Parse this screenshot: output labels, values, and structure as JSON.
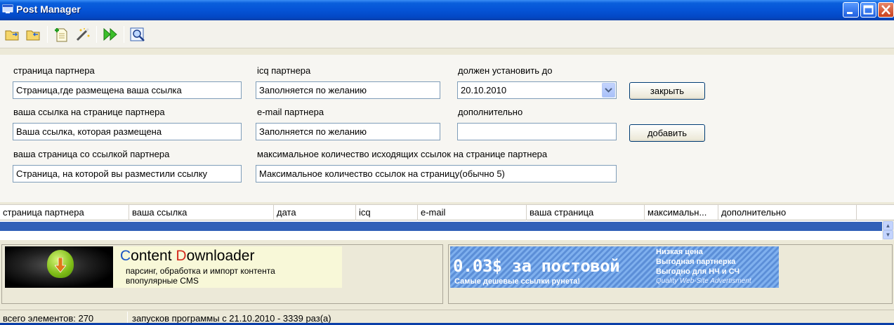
{
  "window": {
    "title": "Post Manager"
  },
  "form": {
    "partner_page": {
      "label": "страница партнера",
      "value": "Страница,где размещена ваша ссылка"
    },
    "partner_icq": {
      "label": "icq партнера",
      "value": "Заполняется по желанию"
    },
    "deadline": {
      "label": "должен установить до",
      "value": "20.10.2010"
    },
    "your_link": {
      "label": "ваша ссылка на странице партнера",
      "value": "Ваша ссылка, которая размещена"
    },
    "partner_email": {
      "label": "e-mail партнера",
      "value": "Заполняется по желанию"
    },
    "extra": {
      "label": "дополнительно",
      "value": ""
    },
    "your_page": {
      "label": "ваша страница со ссылкой партнера",
      "value": "Страница, на которой вы разместили ссылку"
    },
    "max_links": {
      "label": "максимальное количество исходящих ссылок на странице партнера",
      "value": "Максимальное количество ссылок на страницу(обычно 5)"
    },
    "close_button": "закрыть",
    "add_button": "добавить"
  },
  "grid": {
    "columns": [
      "страница партнера",
      "ваша ссылка",
      "дата",
      "icq",
      "e-mail",
      "ваша страница",
      "максимальн...",
      "дополнительно"
    ]
  },
  "banners": {
    "left": {
      "title_first_c": "C",
      "title_rest_1": "ontent ",
      "title_first_d": "D",
      "title_rest_2": "ownloader",
      "subtitle_line1": "парсинг, обработка и импорт контента",
      "subtitle_line2": "впопулярные CMS"
    },
    "right": {
      "main": "0.03$ за постовой",
      "sub": "Самые дешевые ссылки рунета!",
      "line1": "Низкая цена",
      "line2": "Выгодная партнерка",
      "line3": "Выгодно для НЧ и СЧ",
      "line4": "Quality Web-Site Advertisment"
    }
  },
  "status": {
    "elements": "всего элементов: 270",
    "launches": "запусков программы с 21.10.2010 - 3339 раз(а)"
  },
  "colors": {
    "titlebar": "#0553d6",
    "selection": "#3160b8"
  }
}
